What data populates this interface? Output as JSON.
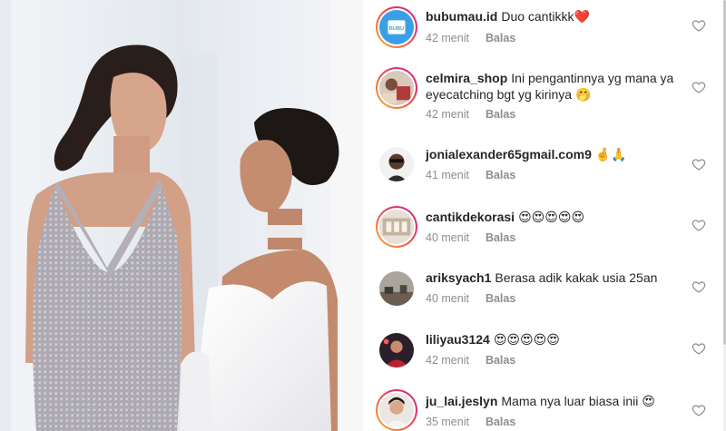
{
  "comments": [
    {
      "username": "bubumau.id",
      "text": "Duo cantikkk❤️",
      "time": "42 menit",
      "reply": "Balas",
      "story_ring": true,
      "avatar_icon": "bubumau-logo-avatar"
    },
    {
      "username": "celmira_shop",
      "text": "Ini pengantinnya yg mana ya eyecatching bgt yg kirinya 🤭",
      "time": "42 menit",
      "reply": "Balas",
      "story_ring": true,
      "avatar_icon": "shop-photo-avatar"
    },
    {
      "username": "jonialexander65gmail.com9",
      "text": "🤞🙏",
      "time": "41 menit",
      "reply": "Balas",
      "story_ring": false,
      "avatar_icon": "man-sunglasses-avatar"
    },
    {
      "username": "cantikdekorasi",
      "text": "😍😍😍😍😍",
      "time": "40 menit",
      "reply": "Balas",
      "story_ring": true,
      "avatar_icon": "decoration-photo-avatar"
    },
    {
      "username": "ariksyach1",
      "text": "Berasa adik kakak usia 25an",
      "time": "40 menit",
      "reply": "Balas",
      "story_ring": false,
      "avatar_icon": "landscape-photo-avatar"
    },
    {
      "username": "liliyau3124",
      "text": "😍😍😍😍😍",
      "time": "42 menit",
      "reply": "Balas",
      "story_ring": false,
      "avatar_icon": "person-red-photo-avatar"
    },
    {
      "username": "ju_lai.jeslyn",
      "text": "Mama nya luar biasa inii 😍",
      "time": "35 menit",
      "reply": "Balas",
      "story_ring": true,
      "avatar_icon": "woman-portrait-avatar"
    }
  ],
  "icons": {
    "like": "heart-outline-icon"
  },
  "colors": {
    "username": "#262626",
    "meta": "#8e8e8e",
    "story_ring_start": "#f7b733",
    "story_ring_end": "#c13584",
    "heart_stroke": "#8e8e8e"
  }
}
